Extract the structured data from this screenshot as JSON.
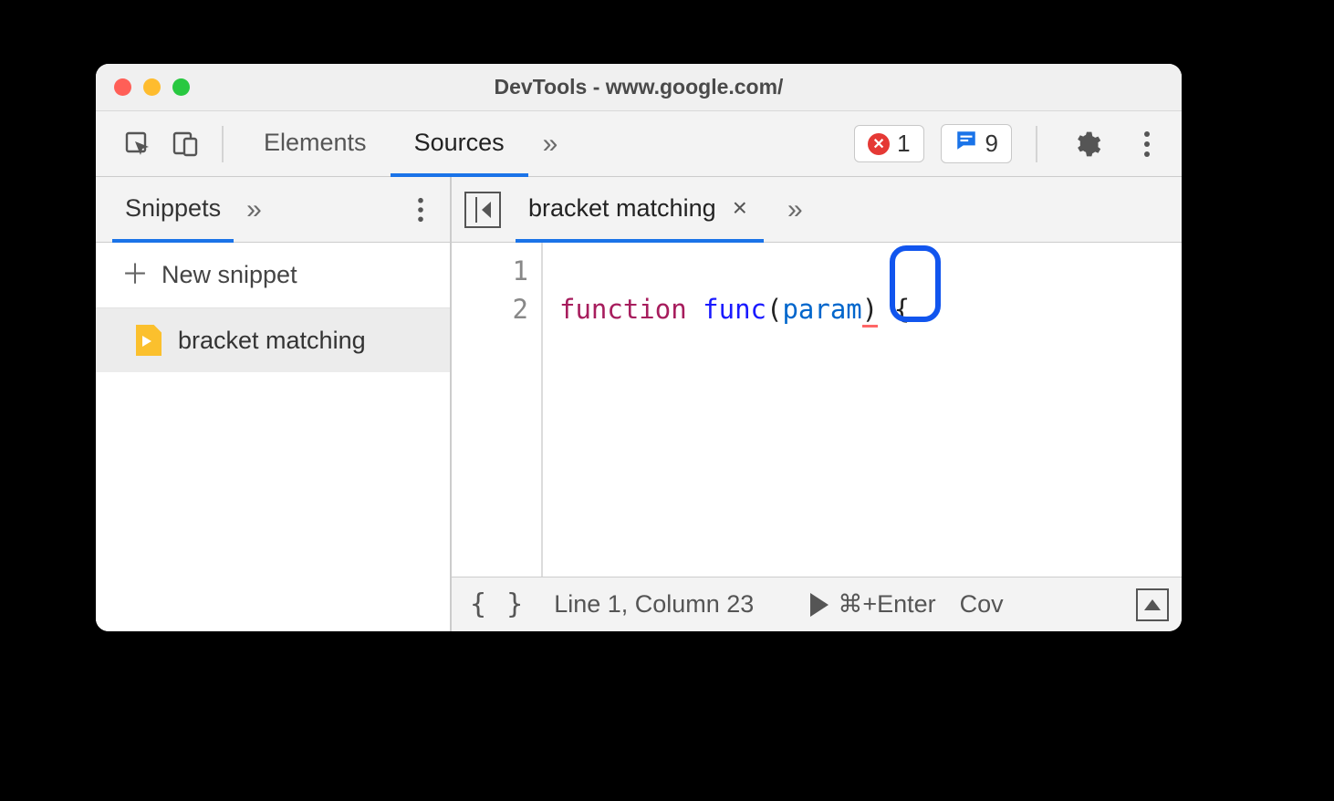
{
  "window": {
    "title": "DevTools - www.google.com/"
  },
  "toolbar": {
    "tabs": {
      "elements": "Elements",
      "sources": "Sources"
    },
    "errors_count": "1",
    "messages_count": "9"
  },
  "left": {
    "tab": "Snippets",
    "new_snippet": "New snippet",
    "file": "bracket matching"
  },
  "editor": {
    "tab_name": "bracket matching",
    "gutter": {
      "l1": "1",
      "l2": "2"
    },
    "code": {
      "keyword": "function",
      "funcname": "func",
      "open_paren": "(",
      "param": "param",
      "close_paren": ")",
      "space": " ",
      "brace": "{"
    }
  },
  "status": {
    "braces": "{ }",
    "position": "Line 1, Column 23",
    "run_hint": "⌘+Enter",
    "coverage": "Cov"
  }
}
